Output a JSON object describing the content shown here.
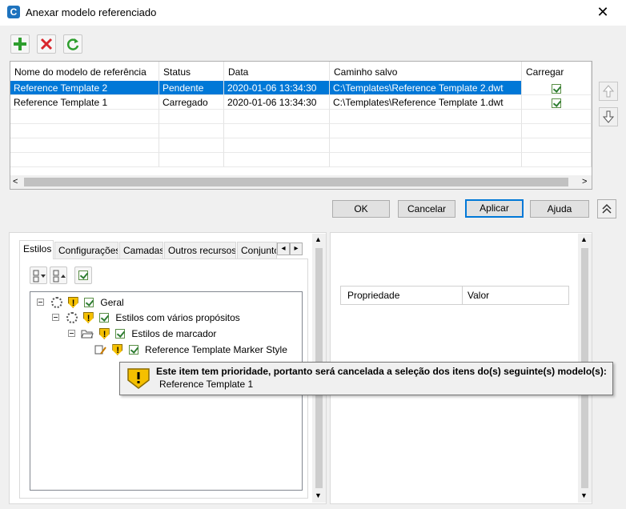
{
  "window": {
    "title": "Anexar modelo referenciado",
    "app_icon_letter": "C",
    "close_glyph": "✕"
  },
  "toolbar": {
    "add_icon": "plus-icon",
    "remove_icon": "delete-x-icon",
    "refresh_icon": "refresh-icon"
  },
  "grid": {
    "columns": [
      "Nome do modelo de referência",
      "Status",
      "Data",
      "Caminho salvo",
      "Carregar"
    ],
    "rows": [
      {
        "name": "Reference Template 2",
        "status": "Pendente",
        "date": "2020-01-06 13:34:30",
        "path": "C:\\Templates\\Reference Template 2.dwt",
        "load": true,
        "selected": true
      },
      {
        "name": "Reference Template 1",
        "status": "Carregado",
        "date": "2020-01-06 13:34:30",
        "path": "C:\\Templates\\Reference Template 1.dwt",
        "load": true,
        "selected": false
      }
    ],
    "scroll_left_glyph": "<",
    "scroll_right_glyph": ">"
  },
  "side_buttons": {
    "up_icon": "arrow-up-icon",
    "down_icon": "arrow-down-icon"
  },
  "buttons": {
    "ok": "OK",
    "cancel": "Cancelar",
    "apply": "Aplicar",
    "help": "Ajuda",
    "collapse_icon": "double-chevron-up-icon"
  },
  "tabs": [
    "Estilos",
    "Configurações",
    "Camadas",
    "Outros recursos",
    "Conjuntos"
  ],
  "tab_scroll": {
    "left": "◂",
    "right": "▸"
  },
  "tree": {
    "items": [
      {
        "label": "Geral",
        "level": 0,
        "checked": true
      },
      {
        "label": "Estilos com vários propósitos",
        "level": 1,
        "checked": true
      },
      {
        "label": "Estilos de marcador",
        "level": 2,
        "checked": true
      },
      {
        "label": "Reference Template Marker Style",
        "level": 3,
        "checked": true
      }
    ]
  },
  "property_grid": {
    "columns": [
      "Propriedade",
      "Valor"
    ]
  },
  "tooltip": {
    "title": "Este item tem prioridade, portanto será cancelada a seleção dos itens do(s) seguinte(s) modelo(s):",
    "detail": "Reference Template 1"
  },
  "colors": {
    "selection": "#0078d7",
    "warning": "#f5c000",
    "add_green": "#2e9e2e",
    "delete_red": "#d9262c"
  }
}
